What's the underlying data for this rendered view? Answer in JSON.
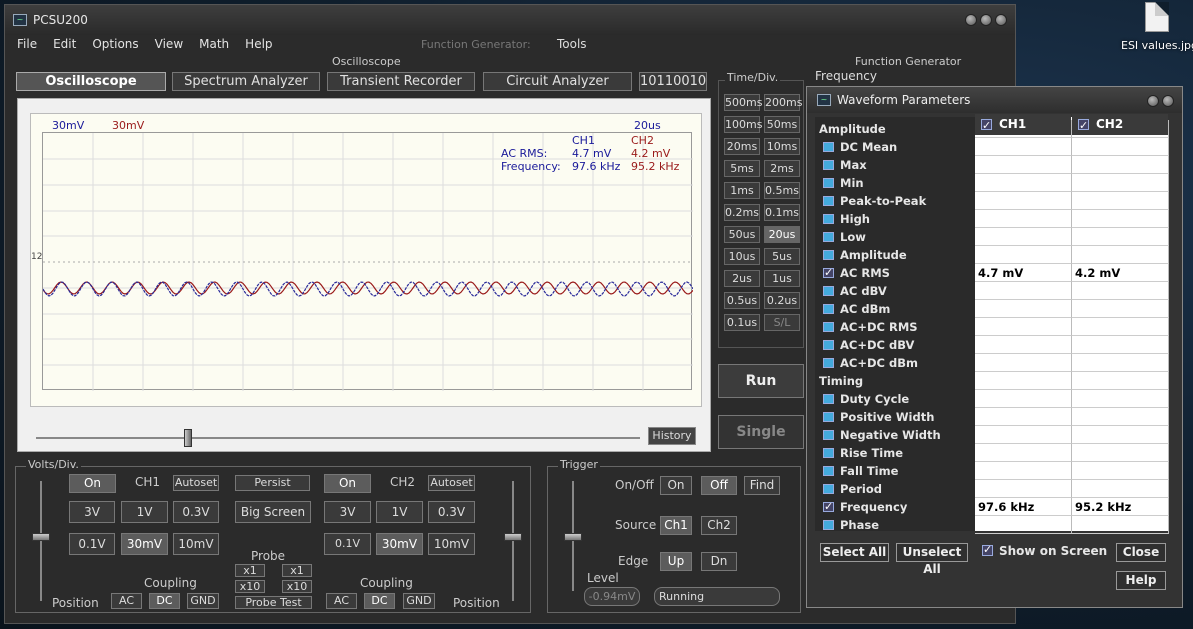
{
  "desktop": {
    "icon_label": "ESI values.jpg"
  },
  "window": {
    "title": "PCSU200"
  },
  "menu": [
    "File",
    "Edit",
    "Options",
    "View",
    "Math",
    "Help"
  ],
  "top_tabs": {
    "oscilloscope": "Oscilloscope",
    "function_generator": "Function Generator:",
    "tools": "Tools",
    "function_generator_right": "Function Generator"
  },
  "modes": [
    "Oscilloscope",
    "Spectrum Analyzer",
    "Transient Recorder",
    "Circuit Analyzer",
    "10110010"
  ],
  "scope": {
    "ch1_scale": "30mV",
    "ch2_scale": "30mV",
    "timebase": "20us",
    "marker": "12",
    "meas": {
      "h_ch1": "CH1",
      "h_ch2": "CH2",
      "rms_label": "AC RMS:",
      "rms_ch1": "4.7 mV",
      "rms_ch2": "4.2 mV",
      "freq_label": "Frequency:",
      "freq_ch1": "97.6 kHz",
      "freq_ch2": "95.2 kHz"
    },
    "history": "History"
  },
  "timediv": {
    "label": "Time/Div.",
    "buttons": [
      "500ms",
      "200ms",
      "100ms",
      "50ms",
      "20ms",
      "10ms",
      "5ms",
      "2ms",
      "1ms",
      "0.5ms",
      "0.2ms",
      "0.1ms",
      "50us",
      "20us",
      "10us",
      "5us",
      "2us",
      "1us",
      "0.5us",
      "0.2us",
      "0.1us",
      "S/L"
    ],
    "run": "Run",
    "single": "Single"
  },
  "frequency_label": "Frequency",
  "volts": {
    "label": "Volts/Div.",
    "on": "On",
    "ch1": "CH1",
    "ch2": "CH2",
    "autoset": "Autoset",
    "persist": "Persist",
    "big_screen": "Big Screen",
    "v3": "3V",
    "v1": "1V",
    "v03": "0.3V",
    "v01": "0.1V",
    "v30m": "30mV",
    "v10m": "10mV",
    "probe": "Probe",
    "x1": "x1",
    "x10": "x10",
    "probe_test": "Probe Test",
    "coupling": "Coupling",
    "ac": "AC",
    "dc": "DC",
    "gnd": "GND",
    "position": "Position"
  },
  "trigger": {
    "label": "Trigger",
    "onoff": "On/Off",
    "on": "On",
    "off": "Off",
    "find": "Find",
    "source": "Source",
    "ch1": "Ch1",
    "ch2": "Ch2",
    "edge": "Edge",
    "up": "Up",
    "dn": "Dn",
    "level": "Level",
    "level_value": "-0.94mV",
    "status": "Running"
  },
  "waveform_params": {
    "title": "Waveform Parameters",
    "ch1": "CH1",
    "ch2": "CH2",
    "rows": [
      {
        "name": "Amplitude",
        "header": true
      },
      {
        "name": "DC  Mean"
      },
      {
        "name": "Max"
      },
      {
        "name": "Min"
      },
      {
        "name": "Peak-to-Peak"
      },
      {
        "name": "High"
      },
      {
        "name": "Low"
      },
      {
        "name": "Amplitude"
      },
      {
        "name": "AC RMS",
        "checked": true,
        "ch1": "4.7 mV",
        "ch2": "4.2 mV"
      },
      {
        "name": "AC dBV"
      },
      {
        "name": "AC dBm"
      },
      {
        "name": "AC+DC RMS"
      },
      {
        "name": "AC+DC dBV"
      },
      {
        "name": "AC+DC dBm"
      },
      {
        "name": "Timing",
        "header": true
      },
      {
        "name": "Duty Cycle"
      },
      {
        "name": "Positive Width"
      },
      {
        "name": "Negative Width"
      },
      {
        "name": "Rise Time"
      },
      {
        "name": "Fall Time"
      },
      {
        "name": "Period"
      },
      {
        "name": "Frequency",
        "checked": true,
        "ch1": "97.6 kHz",
        "ch2": "95.2 kHz"
      },
      {
        "name": "Phase"
      }
    ],
    "select_all": "Select All",
    "unselect_all": "Unselect All",
    "show_on_screen": "Show on Screen",
    "close": "Close",
    "help": "Help"
  }
}
